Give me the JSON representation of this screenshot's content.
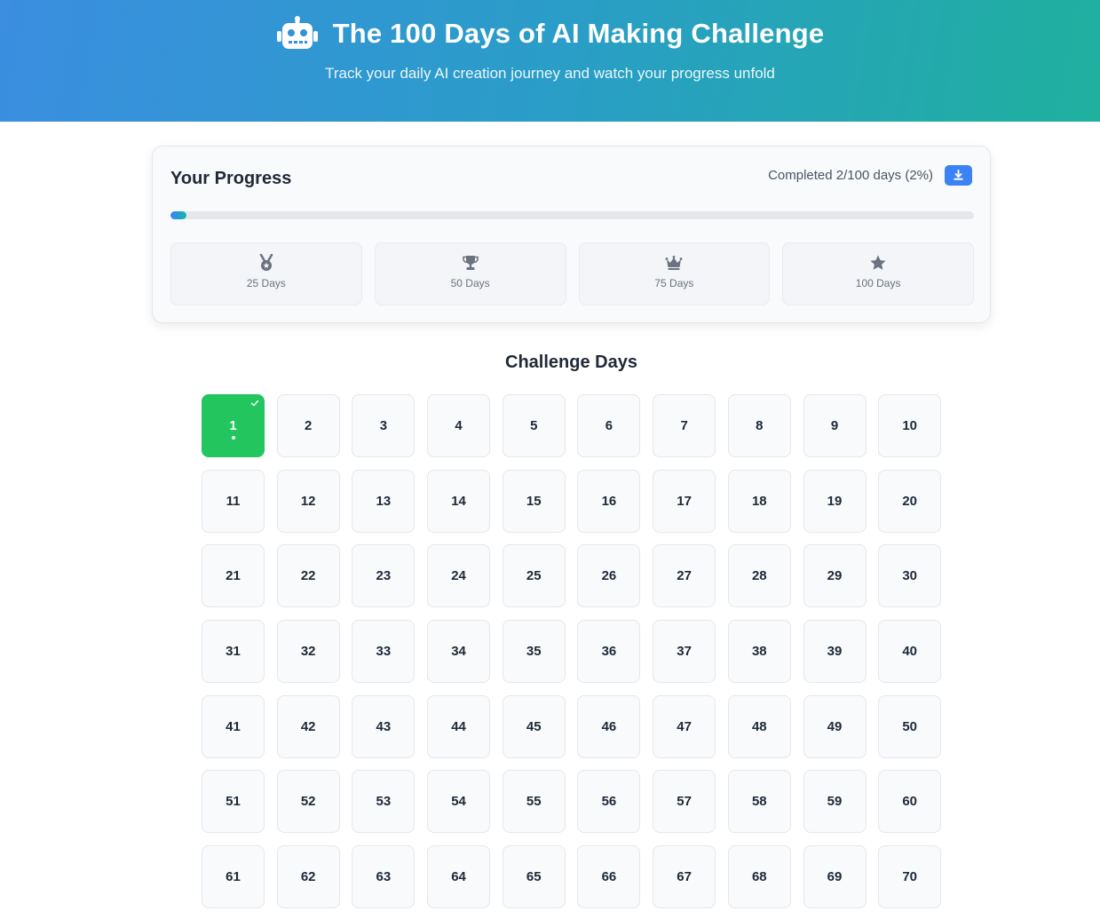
{
  "header": {
    "icon": "robot-icon",
    "title": "The 100 Days of AI Making Challenge",
    "subtitle": "Track your daily AI creation journey and watch your progress unfold"
  },
  "progress": {
    "title": "Your Progress",
    "completed_text": "Completed 2/100 days (2%)",
    "percent": 2,
    "download_icon": "download-icon",
    "milestones": [
      {
        "label": "25 Days",
        "icon": "medal-icon"
      },
      {
        "label": "50 Days",
        "icon": "trophy-icon"
      },
      {
        "label": "75 Days",
        "icon": "crown-icon"
      },
      {
        "label": "100 Days",
        "icon": "star-icon"
      }
    ]
  },
  "challenge": {
    "title": "Challenge Days",
    "completed_days": [
      1
    ],
    "days": [
      "1",
      "2",
      "3",
      "4",
      "5",
      "6",
      "7",
      "8",
      "9",
      "10",
      "11",
      "12",
      "13",
      "14",
      "15",
      "16",
      "17",
      "18",
      "19",
      "20",
      "21",
      "22",
      "23",
      "24",
      "25",
      "26",
      "27",
      "28",
      "29",
      "30",
      "31",
      "32",
      "33",
      "34",
      "35",
      "36",
      "37",
      "38",
      "39",
      "40",
      "41",
      "42",
      "43",
      "44",
      "45",
      "46",
      "47",
      "48",
      "49",
      "50",
      "51",
      "52",
      "53",
      "54",
      "55",
      "56",
      "57",
      "58",
      "59",
      "60",
      "61",
      "62",
      "63",
      "64",
      "65",
      "66",
      "67",
      "68",
      "69",
      "70"
    ]
  },
  "colors": {
    "accent_blue": "#3b82f6",
    "completed_green": "#22c55e",
    "header_gradient_start": "#3b8ee0",
    "header_gradient_end": "#1fb09e"
  }
}
